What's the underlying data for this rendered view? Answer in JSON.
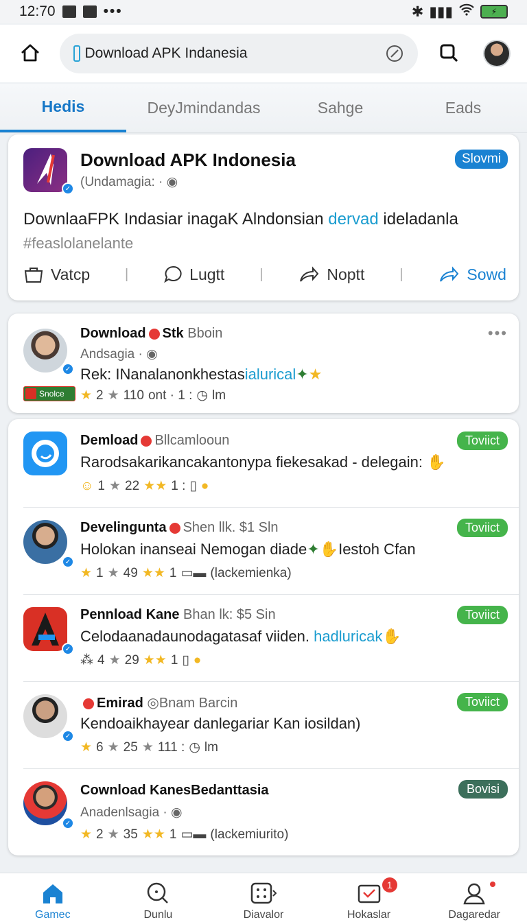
{
  "status": {
    "time": "12:70"
  },
  "search": {
    "value": "Download APK Indanesia"
  },
  "tabs": [
    {
      "label": "Hedis"
    },
    {
      "label": "DeyJmindandas"
    },
    {
      "label": "Sahge"
    },
    {
      "label": "Eads"
    }
  ],
  "featured": {
    "title": "Download APK Indonesia",
    "subtitle": "(Undamagia: ·",
    "badge": "Slovmi",
    "body_text": "DownlaaFPK Indasiar inagaK Alndonsian",
    "body_link": "dervad",
    "body_tail": "ideladanla",
    "hashtag": "#feaslolanelante",
    "actions": {
      "save": "Vatcp",
      "comment": "Lugtt",
      "repost": "Noptt",
      "share": "Sowd"
    }
  },
  "post1": {
    "name": "Download",
    "name_tail": "Stk",
    "name_muted": "Bboin",
    "subtitle": "Andsagia ·",
    "body_text": "Rek: INanalanonkhestas",
    "body_link": "ialurical",
    "store_badge": "Snolce",
    "meta": {
      "a": "2",
      "b": "110",
      "c": "ont · 1 :",
      "d": "lm"
    }
  },
  "posts": [
    {
      "name": "Demload",
      "muted": "Bllcamlooun",
      "body": "Rarodsakarikancakantonypa fiekesakad - delegain:",
      "link": "",
      "meta_a": "1",
      "meta_b": "22",
      "meta_c": "1 :",
      "meta_d": "",
      "pill": "Toviict"
    },
    {
      "name": "Develingunta",
      "muted": "Shen llk. $1 Sln",
      "body": "Holokan inanseai Nemogan diade",
      "link": "Iestoh Cfan",
      "meta_a": "1",
      "meta_b": "49",
      "meta_c": "1",
      "meta_d": "(lackemienka)",
      "pill": "Toviict"
    },
    {
      "name": "Pennload Kane",
      "muted": "Bhan lk: $5 Sin",
      "body": "Celodaanadaunodagatasaf viiden.",
      "link": "hadluricak",
      "meta_a": "4",
      "meta_b": "29",
      "meta_c": "1",
      "meta_d": "",
      "pill": "Toviict"
    },
    {
      "name": "Emirad",
      "muted": "Bnam Barcin",
      "body": "Kendoaikhayear danlegariar Kan iosildan)",
      "link": "",
      "meta_a": "6",
      "meta_b": "25",
      "meta_c": "111 :",
      "meta_d": "lm",
      "pill": "Toviict"
    },
    {
      "name": "Cownload KanesBedanttasia",
      "muted": "",
      "sub": "Anadenlsagia ·",
      "body": "",
      "link": "",
      "meta_a": "2",
      "meta_b": "35",
      "meta_c": "1",
      "meta_d": "(lackemiurito)",
      "pill": "Bovisi"
    }
  ],
  "nav": [
    {
      "label": "Gamec"
    },
    {
      "label": "Dunlu"
    },
    {
      "label": "Diavalor"
    },
    {
      "label": "Hokaslar"
    },
    {
      "label": "Dagaredar"
    }
  ],
  "nav_badge": "1",
  "colors": {
    "accent": "#1a82d2",
    "pill_green": "#45b44b",
    "pill_dark": "#3c6f5b",
    "link": "#1a9ccf"
  }
}
